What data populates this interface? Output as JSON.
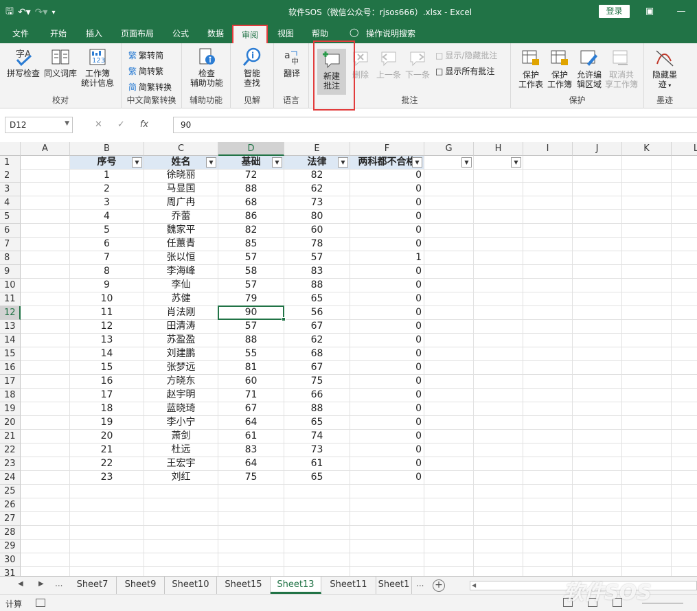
{
  "title": "软件SOS（微信公众号：rjsos666）.xlsx  -  Excel",
  "login_label": "登录",
  "colors": {
    "brand": "#217346",
    "highlight_box": "#e23c3c",
    "header_fill": "#dde8f4"
  },
  "tabs": [
    "文件",
    "开始",
    "插入",
    "页面布局",
    "公式",
    "数据",
    "审阅",
    "视图",
    "帮助",
    "操作说明搜索"
  ],
  "active_tab": "审阅",
  "ribbon": {
    "proofing": {
      "spell": "拼写检查",
      "thesaurus": "同义词库",
      "stats_line1": "工作簿",
      "stats_line2": "统计信息",
      "label": "校对"
    },
    "chinese": {
      "t2s": "繁转简",
      "s2t": "简转繁",
      "convert": "简繁转换",
      "label": "中文简繁转换"
    },
    "access": {
      "line1": "检查",
      "line2": "辅助功能",
      "label": "辅助功能"
    },
    "insights": {
      "line1": "智能",
      "line2": "查找",
      "label": "见解"
    },
    "language": {
      "translate": "翻译",
      "label": "语言"
    },
    "comments": {
      "new_line1": "新建",
      "new_line2": "批注",
      "delete": "删除",
      "prev": "上一条",
      "next": "下一条",
      "show_hide": "显示/隐藏批注",
      "show_all": "显示所有批注",
      "label": "批注"
    },
    "protect": {
      "sheet_l1": "保护",
      "sheet_l2": "工作表",
      "wb_l1": "保护",
      "wb_l2": "工作簿",
      "allow_l1": "允许编",
      "allow_l2": "辑区域",
      "unshare_l1": "取消共",
      "unshare_l2": "享工作簿",
      "label": "保护"
    },
    "ink": {
      "line1": "隐藏墨",
      "line2": "迹",
      "label": "墨迹"
    }
  },
  "formula_bar": {
    "name_box": "D12",
    "fx": "fx",
    "value": "90"
  },
  "columns": [
    "A",
    "B",
    "C",
    "D",
    "E",
    "F",
    "G",
    "H",
    "I",
    "J",
    "K",
    "L"
  ],
  "headers": [
    "序号",
    "姓名",
    "基础",
    "法律",
    "两科都不合格"
  ],
  "rows": [
    [
      "1",
      "徐晓丽",
      "72",
      "82",
      "0"
    ],
    [
      "2",
      "马显国",
      "88",
      "62",
      "0"
    ],
    [
      "3",
      "周广冉",
      "68",
      "73",
      "0"
    ],
    [
      "4",
      "乔蕾",
      "86",
      "80",
      "0"
    ],
    [
      "5",
      "魏家平",
      "82",
      "60",
      "0"
    ],
    [
      "6",
      "任蕙青",
      "85",
      "78",
      "0"
    ],
    [
      "7",
      "张以恒",
      "57",
      "57",
      "1"
    ],
    [
      "8",
      "李海峰",
      "58",
      "83",
      "0"
    ],
    [
      "9",
      "李仙",
      "57",
      "88",
      "0"
    ],
    [
      "10",
      "苏健",
      "79",
      "65",
      "0"
    ],
    [
      "11",
      "肖法刚",
      "90",
      "56",
      "0"
    ],
    [
      "12",
      "田清涛",
      "57",
      "67",
      "0"
    ],
    [
      "13",
      "苏盈盈",
      "88",
      "62",
      "0"
    ],
    [
      "14",
      "刘建鹏",
      "55",
      "68",
      "0"
    ],
    [
      "15",
      "张梦远",
      "81",
      "67",
      "0"
    ],
    [
      "16",
      "方晓东",
      "60",
      "75",
      "0"
    ],
    [
      "17",
      "赵宇明",
      "71",
      "66",
      "0"
    ],
    [
      "18",
      "蓝晓琦",
      "67",
      "88",
      "0"
    ],
    [
      "19",
      "李小宁",
      "64",
      "65",
      "0"
    ],
    [
      "20",
      "萧剑",
      "61",
      "74",
      "0"
    ],
    [
      "21",
      "杜远",
      "83",
      "73",
      "0"
    ],
    [
      "22",
      "王宏宇",
      "64",
      "61",
      "0"
    ],
    [
      "23",
      "刘红",
      "75",
      "65",
      "0"
    ]
  ],
  "row_numbers": [
    "1",
    "2",
    "3",
    "4",
    "5",
    "6",
    "7",
    "8",
    "9",
    "10",
    "11",
    "12",
    "13",
    "14",
    "15",
    "16",
    "17",
    "18",
    "19",
    "20",
    "21",
    "22",
    "23",
    "24",
    "25",
    "26",
    "27",
    "28",
    "29",
    "30",
    "31"
  ],
  "sheets": [
    "Sheet7",
    "Sheet9",
    "Sheet10",
    "Sheet15",
    "Sheet13",
    "Sheet11",
    "Sheet1"
  ],
  "active_sheet": "Sheet13",
  "sheet_ellipsis": "...",
  "status": "计算",
  "watermark": "软件SOS"
}
